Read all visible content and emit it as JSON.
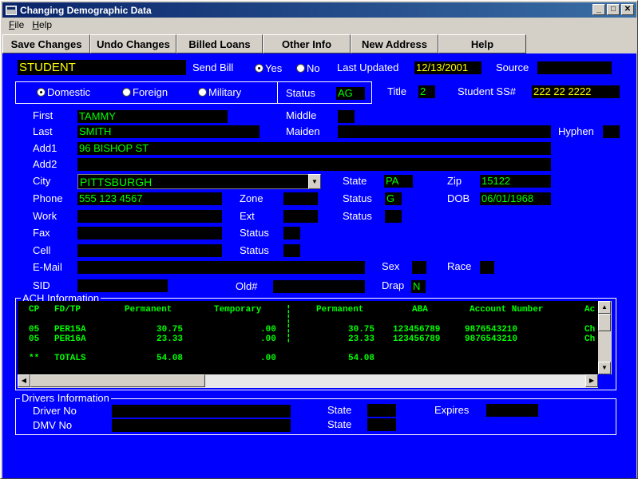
{
  "window": {
    "title": "Changing Demographic Data",
    "minimize": "_",
    "maximize": "□",
    "close": "✕",
    "icon": "app-window-icon"
  },
  "menu": {
    "file": "File",
    "help": "Help"
  },
  "toolbar": {
    "save": "Save Changes",
    "undo": "Undo Changes",
    "billed": "Billed Loans",
    "other": "Other Info",
    "address": "New Address",
    "help": "Help"
  },
  "header": {
    "type": "STUDENT",
    "send_bill_label": "Send Bill",
    "yes": "Yes",
    "no": "No",
    "last_updated_label": "Last Updated",
    "last_updated": "12/13/2001",
    "source_label": "Source",
    "source": ""
  },
  "address_type": {
    "domestic": "Domestic",
    "foreign": "Foreign",
    "military": "Military",
    "status_label": "Status",
    "status": "AG",
    "selected": "Domestic"
  },
  "title_label": "Title",
  "title_value": "2",
  "ssn_label": "Student SS#",
  "ssn": "222 22 2222",
  "person": {
    "first_label": "First",
    "first": "TAMMY",
    "middle_label": "Middle",
    "middle": "",
    "last_label": "Last",
    "last": "SMITH",
    "maiden_label": "Maiden",
    "maiden": "",
    "hyphen_label": "Hyphen",
    "hyphen": "",
    "add1_label": "Add1",
    "add1": "96 BISHOP ST",
    "add2_label": "Add2",
    "add2": "",
    "city_label": "City",
    "city": "PITTSBURGH",
    "state_label": "State",
    "state": "PA",
    "zip_label": "Zip",
    "zip": "15122",
    "phone_label": "Phone",
    "phone": "555 123 4567",
    "zone_label": "Zone",
    "zone": "",
    "phone_status_label": "Status",
    "phone_status": "G",
    "dob_label": "DOB",
    "dob": "06/01/1968",
    "work_label": "Work",
    "work": "",
    "ext_label": "Ext",
    "ext": "",
    "work_status_label": "Status",
    "work_status": "",
    "fax_label": "Fax",
    "fax": "",
    "fax_status_label": "Status",
    "fax_status": "",
    "cell_label": "Cell",
    "cell": "",
    "cell_status_label": "Status",
    "cell_status": "",
    "email_label": "E-Mail",
    "email": "",
    "sex_label": "Sex",
    "sex": "",
    "race_label": "Race",
    "race": "",
    "sid_label": "SID",
    "sid": "",
    "old_label": "Old#",
    "old": "",
    "drap_label": "Drap",
    "drap": "N"
  },
  "ach": {
    "title": "ACH Information",
    "headers": [
      "CP",
      "FD/TP",
      "Permanent",
      "Temporary",
      "Permanent",
      "ABA",
      "Account Number",
      "Ac"
    ],
    "rows": [
      [
        "05",
        "PER15A",
        "30.75",
        ".00",
        "30.75",
        "123456789",
        "9876543210",
        "Ch"
      ],
      [
        "05",
        "PER16A",
        "23.33",
        ".00",
        "23.33",
        "123456789",
        "9876543210",
        "Ch"
      ]
    ],
    "totals": [
      "**",
      "TOTALS",
      "54.08",
      ".00",
      "54.08"
    ]
  },
  "drivers": {
    "title": "Drivers Information",
    "driver_label": "Driver No",
    "driver": "",
    "state1_label": "State",
    "state1": "",
    "expires_label": "Expires",
    "expires": "",
    "dmv_label": "DMV No",
    "dmv": "",
    "state2_label": "State",
    "state2": ""
  },
  "colors": {
    "background": "#0000ff",
    "field": "#000000",
    "value": "#00ff00",
    "highlight": "#ffff00"
  }
}
